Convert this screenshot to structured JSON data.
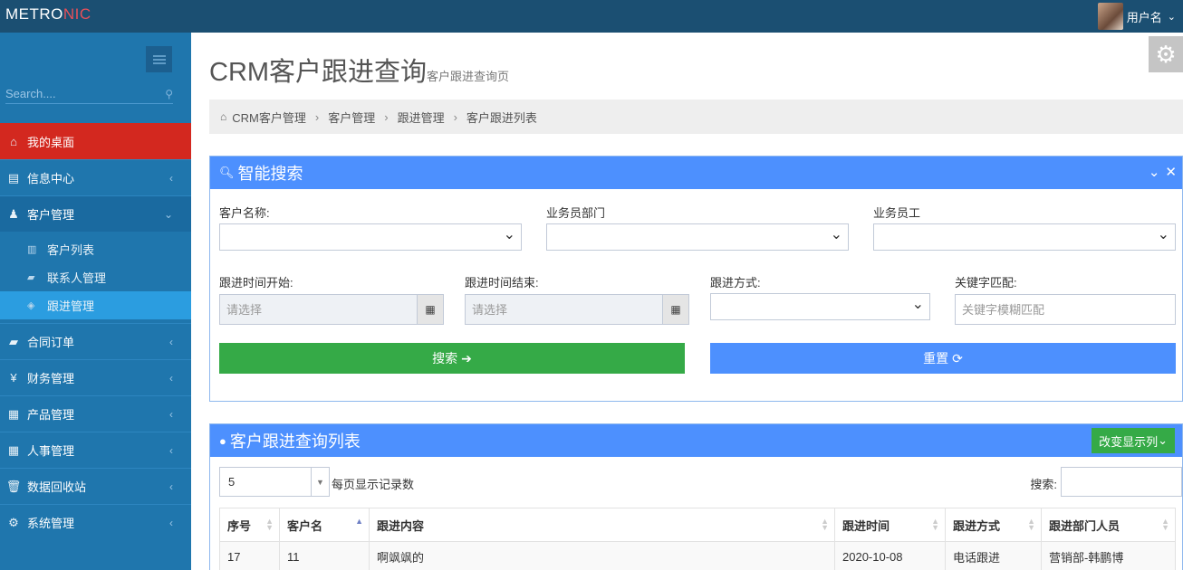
{
  "app": {
    "logo_main": "METRO",
    "logo_accent": "NIC",
    "username": "用户名"
  },
  "sidebar": {
    "search_placeholder": "Search....",
    "items": [
      {
        "label": "我的桌面",
        "icon": "home-icon"
      },
      {
        "label": "信息中心",
        "icon": "message-icon"
      },
      {
        "label": "客户管理",
        "icon": "person-icon"
      },
      {
        "label": "合同订单",
        "icon": "book-icon"
      },
      {
        "label": "财务管理",
        "icon": "yen-icon"
      },
      {
        "label": "产品管理",
        "icon": "table-icon"
      },
      {
        "label": "人事管理",
        "icon": "table-icon"
      },
      {
        "label": "数据回收站",
        "icon": "trash-icon"
      },
      {
        "label": "系统管理",
        "icon": "gear-icon"
      }
    ],
    "subitems": [
      {
        "label": "客户列表"
      },
      {
        "label": "联系人管理"
      },
      {
        "label": "跟进管理"
      }
    ]
  },
  "page": {
    "title": "CRM客户跟进查询",
    "subtitle": "客户跟进查询页"
  },
  "breadcrumb": [
    "CRM客户管理",
    "客户管理",
    "跟进管理",
    "客户跟进列表"
  ],
  "search_panel": {
    "title": "智能搜索",
    "customer_name_label": "客户名称:",
    "dept_label": "业务员部门",
    "staff_label": "业务员工",
    "start_label": "跟进时间开始:",
    "end_label": "跟进时间结束:",
    "method_label": "跟进方式:",
    "keyword_label": "关键字匹配:",
    "date_placeholder": "请选择",
    "keyword_placeholder": "关键字模糊匹配",
    "search_button": "搜索",
    "reset_button": "重置"
  },
  "list_panel": {
    "title": "客户跟进查询列表",
    "change_columns": "改变显示列",
    "page_size": "5",
    "page_size_label": "每页显示记录数",
    "search_label": "搜索:",
    "columns": [
      "序号",
      "客户名",
      "跟进内容",
      "跟进时间",
      "跟进方式",
      "跟进部门人员"
    ],
    "rows": [
      [
        "17",
        "11",
        "啊飒飒的",
        "2020-10-08",
        "电话跟进",
        "营销部-韩鹏博"
      ]
    ]
  }
}
